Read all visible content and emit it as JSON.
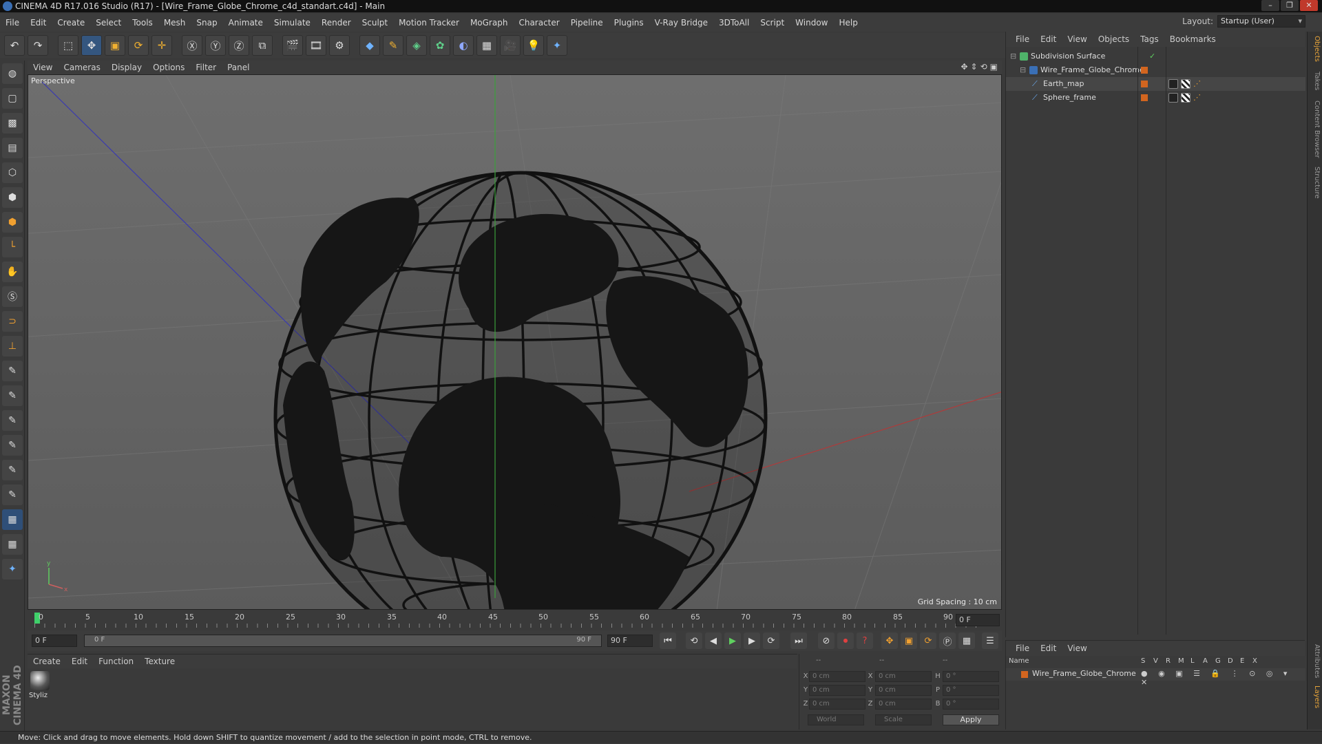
{
  "window": {
    "title": "CINEMA 4D R17.016 Studio (R17) - [Wire_Frame_Globe_Chrome_c4d_standart.c4d] - Main"
  },
  "menubar": [
    "File",
    "Edit",
    "Create",
    "Select",
    "Tools",
    "Mesh",
    "Snap",
    "Animate",
    "Simulate",
    "Render",
    "Sculpt",
    "Motion Tracker",
    "MoGraph",
    "Character",
    "Pipeline",
    "Plugins",
    "V-Ray Bridge",
    "3DToAll",
    "Script",
    "Window",
    "Help"
  ],
  "layout": {
    "label": "Layout:",
    "value": "Startup (User)"
  },
  "viewport": {
    "menu": [
      "View",
      "Cameras",
      "Display",
      "Options",
      "Filter",
      "Panel"
    ],
    "camera_label": "Perspective",
    "grid_spacing": "Grid Spacing : 10 cm"
  },
  "timeline": {
    "ticks": [
      "0",
      "5",
      "10",
      "15",
      "20",
      "25",
      "30",
      "35",
      "40",
      "45",
      "50",
      "55",
      "60",
      "65",
      "70",
      "75",
      "80",
      "85",
      "90"
    ],
    "current_frame": "0 F",
    "start_field": "0 F",
    "slider_start": "0 F",
    "slider_end": "90 F",
    "end_field": "90 F",
    "active_frame": 0
  },
  "material_panel": {
    "menu": [
      "Create",
      "Edit",
      "Function",
      "Texture"
    ],
    "material_name": "Styliz"
  },
  "coord_panel": {
    "headers": [
      "--",
      "--",
      "--"
    ],
    "rows": [
      {
        "l1": "X",
        "v1": "0 cm",
        "l2": "X",
        "v2": "0 cm",
        "l3": "H",
        "v3": "0 °"
      },
      {
        "l1": "Y",
        "v1": "0 cm",
        "l2": "Y",
        "v2": "0 cm",
        "l3": "P",
        "v3": "0 °"
      },
      {
        "l1": "Z",
        "v1": "0 cm",
        "l2": "Z",
        "v2": "0 cm",
        "l3": "B",
        "v3": "0 °"
      }
    ],
    "world_select": "World",
    "scale_select": "Scale",
    "apply_label": "Apply"
  },
  "object_manager": {
    "menu": [
      "File",
      "Edit",
      "View",
      "Objects",
      "Tags",
      "Bookmarks"
    ],
    "objects": [
      {
        "name": "Subdivision Surface"
      },
      {
        "name": "Wire_Frame_Globe_Chrome"
      },
      {
        "name": "Earth_map"
      },
      {
        "name": "Sphere_frame"
      }
    ]
  },
  "layer_manager": {
    "menu": [
      "File",
      "Edit",
      "View"
    ],
    "columns": [
      "Name",
      "S",
      "V",
      "R",
      "M",
      "L",
      "A",
      "G",
      "D",
      "E",
      "X"
    ],
    "layer_name": "Wire_Frame_Globe_Chrome"
  },
  "right_tabs": [
    "Objects",
    "Takes",
    "Content Browser",
    "Structure",
    "Attributes",
    "Layers"
  ],
  "status": "Move: Click and drag to move elements. Hold down SHIFT to quantize movement / add to the selection in point mode, CTRL to remove.",
  "brand": "MAXON CINEMA 4D"
}
